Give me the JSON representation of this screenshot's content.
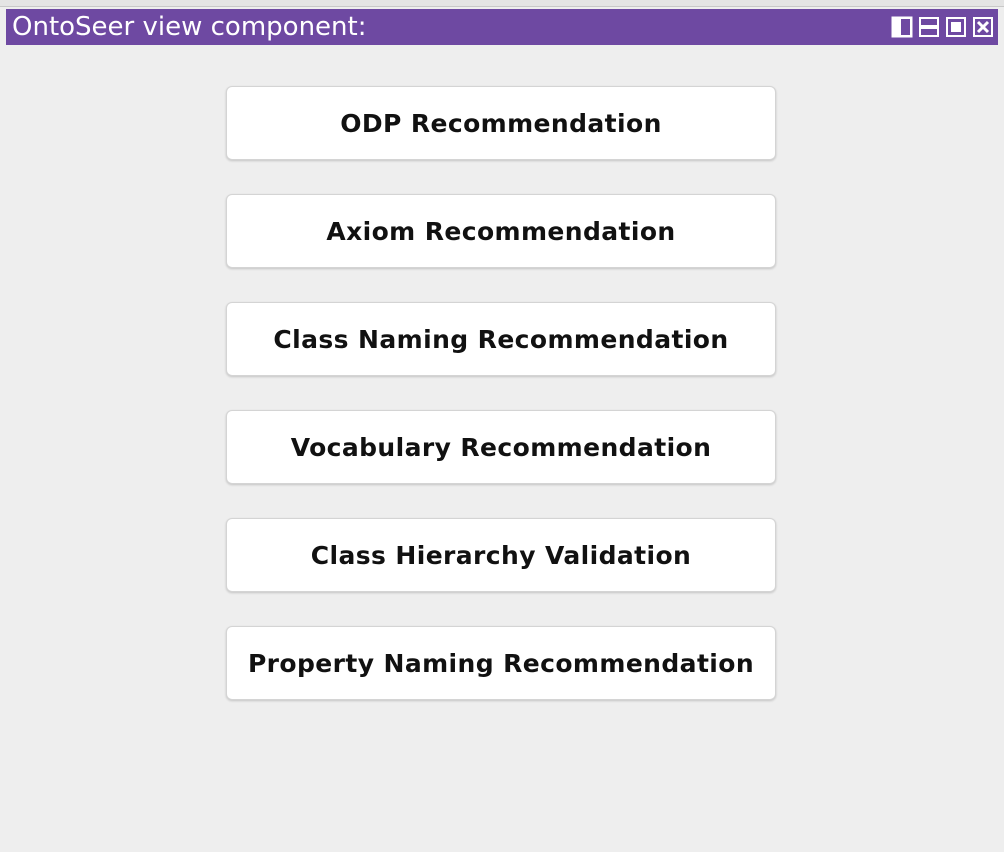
{
  "window": {
    "title": "OntoSeer view component:",
    "title_bar_color": "#6e49a2",
    "controls": [
      "split-view-icon",
      "minimize-icon",
      "maximize-icon",
      "close-icon"
    ]
  },
  "buttons": [
    {
      "label": "ODP Recommendation"
    },
    {
      "label": "Axiom Recommendation"
    },
    {
      "label": "Class Naming Recommendation"
    },
    {
      "label": "Vocabulary Recommendation"
    },
    {
      "label": "Class Hierarchy Validation"
    },
    {
      "label": "Property Naming Recommendation"
    }
  ]
}
